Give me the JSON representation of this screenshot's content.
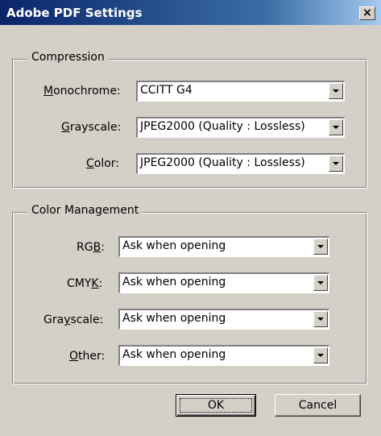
{
  "window": {
    "title": "Adobe PDF Settings",
    "close_glyph": "×"
  },
  "compression": {
    "group_label": "Compression",
    "monochrome": {
      "label_pre": "",
      "label_key": "M",
      "label_post": "onochrome:",
      "value": "CCITT G4"
    },
    "grayscale": {
      "label_pre": "",
      "label_key": "G",
      "label_post": "rayscale:",
      "value": "JPEG2000 (Quality : Lossless)"
    },
    "color": {
      "label_pre": "",
      "label_key": "C",
      "label_post": "olor:",
      "value": "JPEG2000 (Quality : Lossless)"
    }
  },
  "color_management": {
    "group_label": "Color Management",
    "rgb": {
      "label_pre": "RG",
      "label_key": "B",
      "label_post": ":",
      "value": "Ask when opening"
    },
    "cmyk": {
      "label_pre": "CMY",
      "label_key": "K",
      "label_post": ":",
      "value": "Ask when opening"
    },
    "grayscale": {
      "label_pre": "Gra",
      "label_key": "y",
      "label_post": "scale:",
      "value": "Ask when opening"
    },
    "other": {
      "label_pre": "",
      "label_key": "O",
      "label_post": "ther:",
      "value": "Ask when opening"
    }
  },
  "buttons": {
    "ok": "OK",
    "cancel": "Cancel"
  }
}
